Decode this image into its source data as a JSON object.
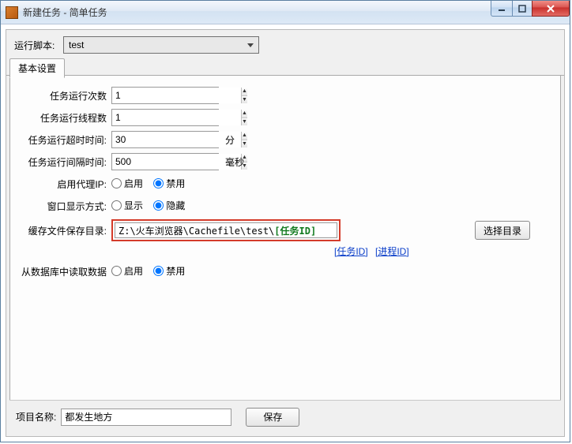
{
  "window": {
    "title": "新建任务 - 简单任务"
  },
  "script": {
    "label": "运行脚本:",
    "selected": "test"
  },
  "tabs": {
    "basic": "基本设置"
  },
  "form": {
    "run_count_label": "任务运行次数",
    "run_count": "1",
    "thread_count_label": "任务运行线程数",
    "thread_count": "1",
    "timeout_label": "任务运行超时时间:",
    "timeout": "30",
    "timeout_unit": "分",
    "interval_label": "任务运行间隔时间:",
    "interval": "500",
    "interval_unit": "毫秒",
    "proxy_label": "启用代理IP:",
    "window_mode_label": "窗口显示方式:",
    "cache_dir_label": "缓存文件保存目录:",
    "cache_dir_prefix": "Z:\\火车浏览器\\Cachefile\\test\\",
    "cache_dir_token": "[任务ID]",
    "select_dir": "选择目录",
    "read_db_label": "从数据库中读取数据"
  },
  "radios": {
    "enable": "启用",
    "disable": "禁用",
    "show": "显示",
    "hide": "隐藏"
  },
  "links": {
    "task_id": "[任务ID]",
    "process_id": "[进程ID]"
  },
  "bottom": {
    "project_label": "项目名称:",
    "project_name": "都发生地方",
    "save": "保存"
  }
}
